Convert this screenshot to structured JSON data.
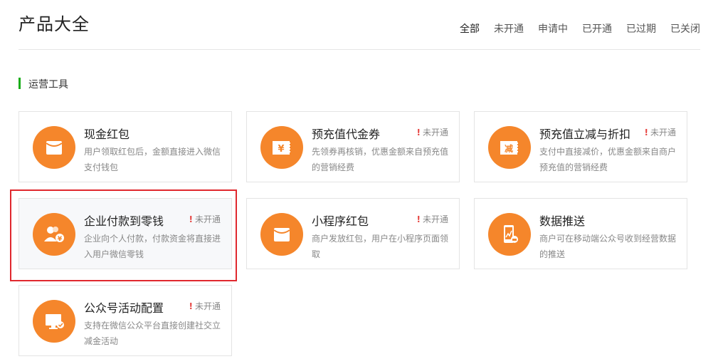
{
  "page_title": "产品大全",
  "filter_tabs": [
    "全部",
    "未开通",
    "申请中",
    "已开通",
    "已过期",
    "已关闭"
  ],
  "section_title": "运营工具",
  "cards": [
    {
      "title": "现金红包",
      "desc": "用户领取红包后，金额直接进入微信支付钱包",
      "status": "",
      "icon": "red-envelope-icon"
    },
    {
      "title": "预充值代金券",
      "desc": "先领券再核销，优惠金额来自预充值的营销经费",
      "status": "未开通",
      "icon": "yuan-coupon-icon"
    },
    {
      "title": "预充值立减与折扣",
      "desc": "支付中直接减价，优惠金额来自商户预充值的营销经费",
      "status": "未开通",
      "icon": "discount-coupon-icon"
    },
    {
      "title": "企业付款到零钱",
      "desc": "企业向个人付款，付款资金将直接进入用户微信零钱",
      "status": "未开通",
      "icon": "users-payment-icon"
    },
    {
      "title": "小程序红包",
      "desc": "商户发放红包，用户在小程序页面领取",
      "status": "未开通",
      "icon": "mini-program-envelope-icon"
    },
    {
      "title": "数据推送",
      "desc": "商户可在移动端公众号收到经营数据的推送",
      "status": "",
      "icon": "mobile-data-icon"
    },
    {
      "title": "公众号活动配置",
      "desc": "支持在微信公众平台直接创建社交立减金活动",
      "status": "未开通",
      "icon": "campaign-config-icon"
    }
  ],
  "colors": {
    "accent": "#f5862b",
    "section_bar": "#1aad19",
    "status_alert": "#e64340",
    "highlight_frame": "#e0282e"
  }
}
